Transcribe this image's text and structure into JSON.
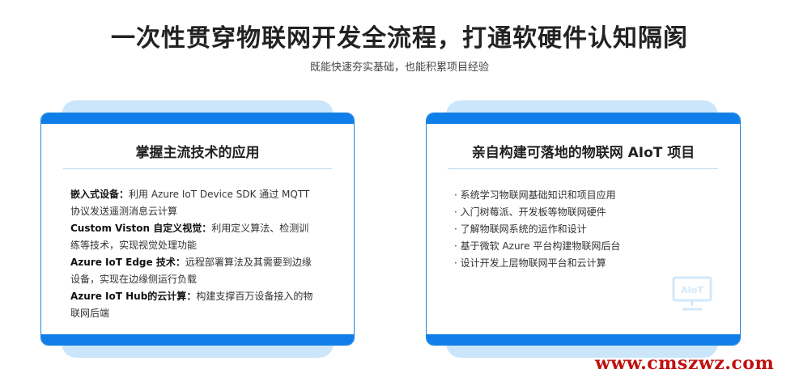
{
  "header": {
    "title": "一次性贯穿物联网开发全流程，打通软硬件认知隔阂",
    "subtitle": "既能快速夯实基础，也能积累项目经验"
  },
  "left_card": {
    "title": "掌握主流技术的应用",
    "items": [
      {
        "term": "嵌入式设备",
        "sep": "：",
        "line1": "利用 Azure IoT Device SDK 通过 MQTT",
        "line2": "协议发送遥测消息云计算"
      },
      {
        "term": "Custom  Viston  自定义视觉",
        "sep": "：",
        "line1": "利用定义算法、检测训",
        "line2": "练等技术，实现视觉处理功能"
      },
      {
        "term": "Azure  IoT  Edge 技术",
        "sep": "：",
        "line1": "远程部署算法及其需要到边缘",
        "line2": "设备，实现在边缘侧运行负载"
      },
      {
        "term": "Azure  IoT  Hub的云计算",
        "sep": "：",
        "line1": "构建支撑百万设备接入的物",
        "line2": "联网后端"
      }
    ]
  },
  "right_card": {
    "title": "亲自构建可落地的物联网 AIoT 项目",
    "items": [
      "· 系统学习物联网基础知识和项目应用",
      "· 入门树莓派、开发板等物联网硬件",
      "· 了解物联网系统的运作和设计",
      "· 基于微软 Azure 平台构建物联网后台",
      "· 设计开发上层物联网平台和云计算"
    ],
    "icon_label": "AIoT"
  },
  "watermark": "www.cmszwz.com"
}
